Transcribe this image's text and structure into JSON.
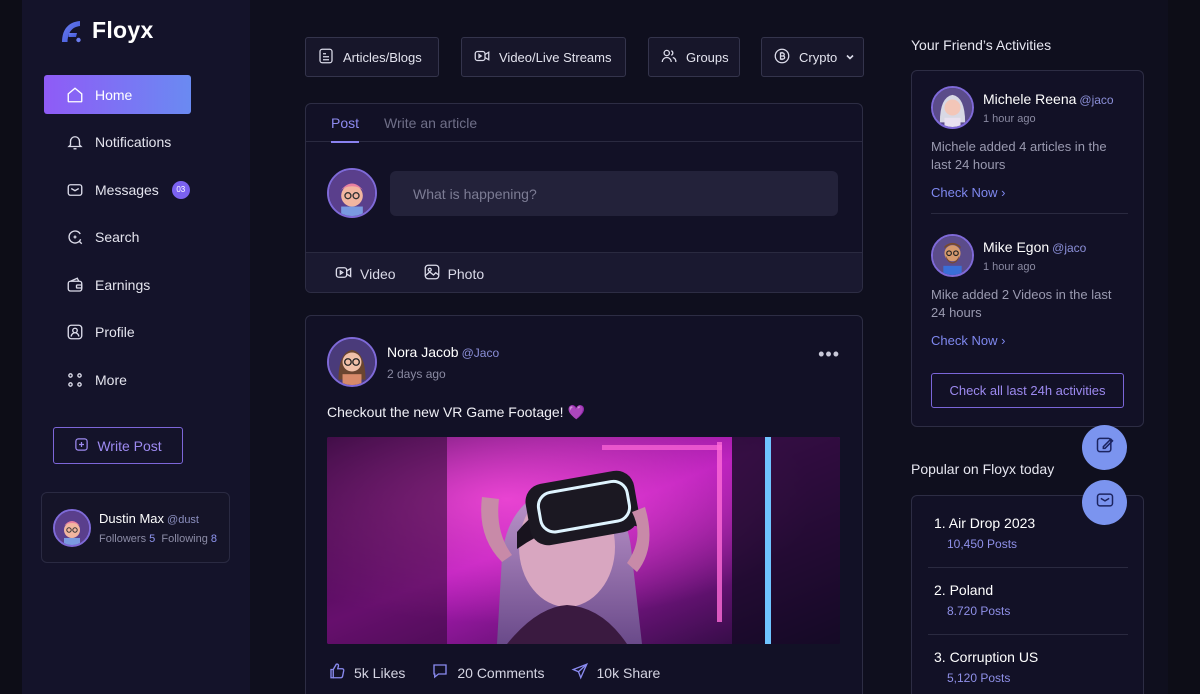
{
  "app": {
    "name": "Floyx"
  },
  "sidebar": {
    "items": [
      {
        "label": "Home",
        "icon": "home-icon",
        "active": true
      },
      {
        "label": "Notifications",
        "icon": "bell-icon"
      },
      {
        "label": "Messages",
        "icon": "mail-icon",
        "badge": "03"
      },
      {
        "label": "Search",
        "icon": "search-icon"
      },
      {
        "label": "Earnings",
        "icon": "wallet-icon"
      },
      {
        "label": "Profile",
        "icon": "profile-icon"
      },
      {
        "label": "More",
        "icon": "grid-dots-icon"
      }
    ],
    "write_post": "Write Post",
    "profile": {
      "name": "Dustin Max",
      "handle": "@dust",
      "followers_label": "Followers",
      "followers": "5",
      "following_label": "Following",
      "following": "8"
    }
  },
  "categories": [
    {
      "label": "Articles/Blogs",
      "icon": "document-icon"
    },
    {
      "label": "Video/Live Streams",
      "icon": "video-icon"
    },
    {
      "label": "Groups",
      "icon": "users-icon"
    },
    {
      "label": "Crypto",
      "icon": "bitcoin-icon",
      "dropdown": true
    }
  ],
  "composer": {
    "tabs": [
      "Post",
      "Write an article"
    ],
    "active_tab": "Post",
    "placeholder": "What is happening?",
    "actions": [
      {
        "label": "Video",
        "icon": "video-icon"
      },
      {
        "label": "Photo",
        "icon": "image-icon"
      }
    ]
  },
  "post": {
    "author": "Nora Jacob",
    "handle": "@Jaco",
    "time": "2 days ago",
    "text": "Checkout the new VR Game Footage! 💜",
    "likes": "5k Likes",
    "comments": "20 Comments",
    "shares": "10k Share"
  },
  "activities": {
    "title": "Your Friend’s Activities",
    "items": [
      {
        "name": "Michele Reena",
        "handle": "@jaco",
        "time": "1 hour ago",
        "desc": "Michele added 4 articles in the last 24 hours",
        "cta": "Check Now"
      },
      {
        "name": "Mike Egon",
        "handle": "@jaco",
        "time": "1 hour ago",
        "desc": "Mike added 2 Videos in the last 24 hours",
        "cta": "Check Now"
      }
    ],
    "check_all": "Check all last 24h activities"
  },
  "popular": {
    "title": "Popular on Floyx today",
    "items": [
      {
        "name": "1. Air Drop 2023",
        "count": "10,450 Posts"
      },
      {
        "name": "2. Poland",
        "count": "8.720 Posts"
      },
      {
        "name": "3. Corruption US",
        "count": "5,120 Posts"
      }
    ]
  },
  "colors": {
    "accent": "#8f5bf6",
    "accent_blue": "#6a8af2",
    "link": "#7f88ef",
    "background": "#0f0f1e",
    "fab": "#7b94ef"
  }
}
